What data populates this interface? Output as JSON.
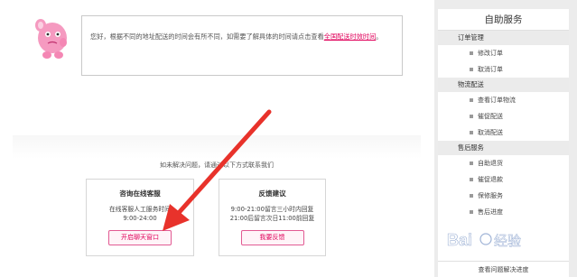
{
  "notice": {
    "text": "您好，根据不同的地址配送的时间会有所不同，如需要了解具体的时间请点击查看",
    "link": "全国配送时效时间",
    "suffix": "。"
  },
  "contact": {
    "prompt": "如未解决问题，请通过以下方式联系我们",
    "online": {
      "title": "咨询在线客服",
      "line1": "在线客服人工服务时间",
      "line2": "9:00-24:00",
      "button": "开启聊天窗口"
    },
    "feedback": {
      "title": "反馈建议",
      "line1": "9:00-21:00留言三小时内回复",
      "line2": "21:00后留言次日11:00前回复",
      "button": "我要反馈"
    }
  },
  "sidebar": {
    "title": "自助服务",
    "sections": [
      {
        "label": "订单管理",
        "items": [
          "修改订单",
          "取消订单"
        ]
      },
      {
        "label": "物流配送",
        "items": [
          "查看订单物流",
          "催促配送",
          "取消配送"
        ]
      },
      {
        "label": "售后服务",
        "items": [
          "自助退货",
          "催促退款",
          "保修服务",
          "售后进度"
        ]
      }
    ],
    "footer": "查看问题解决进度"
  },
  "colors": {
    "accent": "#e0005a",
    "arrow": "#e8322b",
    "sidebar_bg": "#ececec"
  }
}
